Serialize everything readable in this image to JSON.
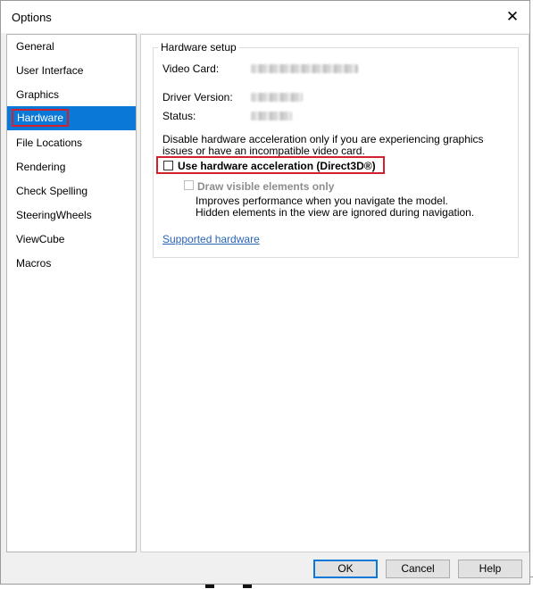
{
  "window": {
    "title": "Options"
  },
  "sidebar": {
    "items": [
      {
        "label": "General"
      },
      {
        "label": "User Interface"
      },
      {
        "label": "Graphics"
      },
      {
        "label": "Hardware",
        "selected": true
      },
      {
        "label": "File Locations"
      },
      {
        "label": "Rendering"
      },
      {
        "label": "Check Spelling"
      },
      {
        "label": "SteeringWheels"
      },
      {
        "label": "ViewCube"
      },
      {
        "label": "Macros"
      }
    ]
  },
  "hardware": {
    "group_title": "Hardware setup",
    "video_card_label": "Video Card:",
    "driver_version_label": "Driver Version:",
    "status_label": "Status:",
    "note": "Disable hardware acceleration only if you are experiencing graphics issues or have an incompatible video card.",
    "use_hw_accel_label": "Use hardware acceleration (Direct3D®)",
    "use_hw_accel_checked": false,
    "draw_visible_label": "Draw visible elements only",
    "draw_visible_checked": false,
    "draw_visible_enabled": false,
    "draw_visible_desc": "Improves performance when you navigate the model. Hidden elements in the view are ignored during navigation.",
    "supported_hardware_link": "Supported hardware"
  },
  "buttons": {
    "ok": "OK",
    "cancel": "Cancel",
    "help": "Help"
  },
  "colors": {
    "selection": "#0a78d7",
    "highlight_frame": "#d3202c",
    "link": "#2a63b8"
  }
}
